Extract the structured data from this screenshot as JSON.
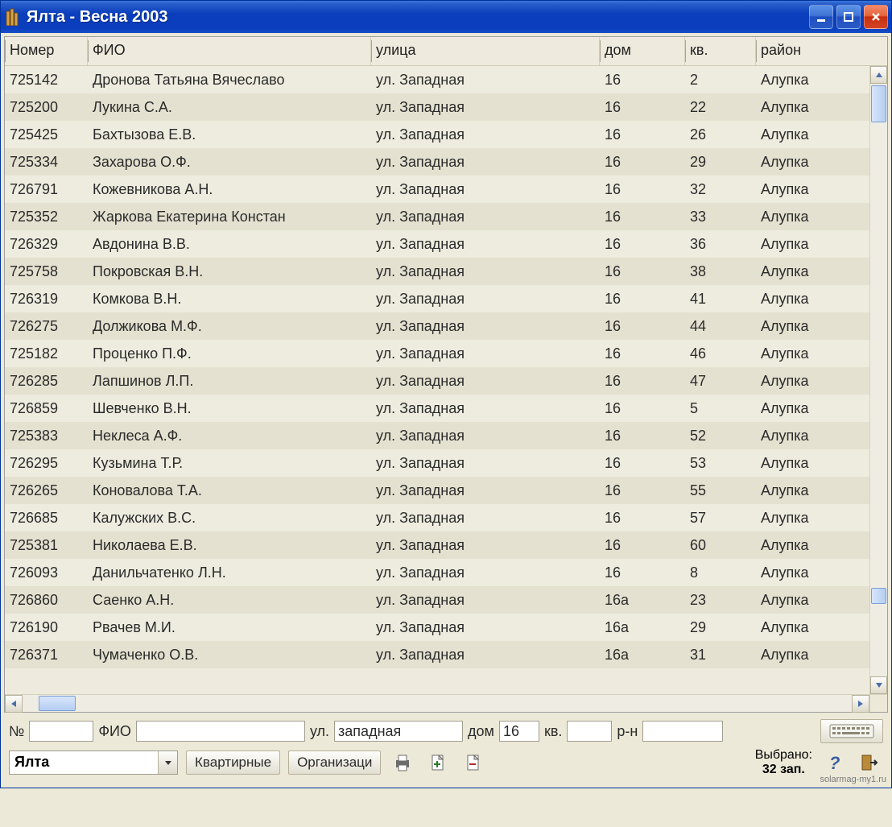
{
  "window": {
    "title": "Ялта  - Весна 2003"
  },
  "columns": {
    "num": "Номер",
    "fio": "ФИО",
    "street": "улица",
    "house": "дом",
    "apt": "кв.",
    "district": "район"
  },
  "rows": [
    {
      "num": "725142",
      "fio": "Дронова Татьяна Вячеславо",
      "street": "ул. Западная",
      "house": "16",
      "apt": "2",
      "district": "Алупка"
    },
    {
      "num": "725200",
      "fio": "Лукина С.А.",
      "street": "ул. Западная",
      "house": "16",
      "apt": "22",
      "district": "Алупка"
    },
    {
      "num": "725425",
      "fio": "Бахтызова Е.В.",
      "street": "ул. Западная",
      "house": "16",
      "apt": "26",
      "district": "Алупка"
    },
    {
      "num": "725334",
      "fio": "Захарова О.Ф.",
      "street": "ул. Западная",
      "house": "16",
      "apt": "29",
      "district": "Алупка"
    },
    {
      "num": "726791",
      "fio": "Кожевникова А.Н.",
      "street": "ул. Западная",
      "house": "16",
      "apt": "32",
      "district": "Алупка"
    },
    {
      "num": "725352",
      "fio": "Жаркова Екатерина Констан",
      "street": "ул. Западная",
      "house": "16",
      "apt": "33",
      "district": "Алупка"
    },
    {
      "num": "726329",
      "fio": "Авдонина В.В.",
      "street": "ул. Западная",
      "house": "16",
      "apt": "36",
      "district": "Алупка"
    },
    {
      "num": "725758",
      "fio": "Покровская В.Н.",
      "street": "ул. Западная",
      "house": "16",
      "apt": "38",
      "district": "Алупка"
    },
    {
      "num": "726319",
      "fio": "Комкова В.Н.",
      "street": "ул. Западная",
      "house": "16",
      "apt": "41",
      "district": "Алупка"
    },
    {
      "num": "726275",
      "fio": "Должикова М.Ф.",
      "street": "ул. Западная",
      "house": "16",
      "apt": "44",
      "district": "Алупка"
    },
    {
      "num": "725182",
      "fio": "Проценко П.Ф.",
      "street": "ул. Западная",
      "house": "16",
      "apt": "46",
      "district": "Алупка"
    },
    {
      "num": "726285",
      "fio": "Лапшинов Л.П.",
      "street": "ул. Западная",
      "house": "16",
      "apt": "47",
      "district": "Алупка"
    },
    {
      "num": "726859",
      "fio": "Шевченко В.Н.",
      "street": "ул. Западная",
      "house": "16",
      "apt": "5",
      "district": "Алупка"
    },
    {
      "num": "725383",
      "fio": "Неклеса А.Ф.",
      "street": "ул. Западная",
      "house": "16",
      "apt": "52",
      "district": "Алупка"
    },
    {
      "num": "726295",
      "fio": "Кузьмина Т.Р.",
      "street": "ул. Западная",
      "house": "16",
      "apt": "53",
      "district": "Алупка"
    },
    {
      "num": "726265",
      "fio": "Коновалова Т.А.",
      "street": "ул. Западная",
      "house": "16",
      "apt": "55",
      "district": "Алупка"
    },
    {
      "num": "726685",
      "fio": "Калужских В.С.",
      "street": "ул. Западная",
      "house": "16",
      "apt": "57",
      "district": "Алупка"
    },
    {
      "num": "725381",
      "fio": "Николаева Е.В.",
      "street": "ул. Западная",
      "house": "16",
      "apt": "60",
      "district": "Алупка"
    },
    {
      "num": "726093",
      "fio": "Данильчатенко Л.Н.",
      "street": "ул. Западная",
      "house": "16",
      "apt": "8",
      "district": "Алупка"
    },
    {
      "num": "726860",
      "fio": "Саенко А.Н.",
      "street": "ул. Западная",
      "house": "16а",
      "apt": "23",
      "district": "Алупка"
    },
    {
      "num": "726190",
      "fio": "Рвачев М.И.",
      "street": "ул. Западная",
      "house": "16а",
      "apt": "29",
      "district": "Алупка"
    },
    {
      "num": "726371",
      "fio": "Чумаченко О.В.",
      "street": "ул. Западная",
      "house": "16а",
      "apt": "31",
      "district": "Алупка"
    }
  ],
  "filter": {
    "labels": {
      "num": "№",
      "fio": "ФИО",
      "street": "ул.",
      "house": "дом",
      "apt": "кв.",
      "district": "р-н"
    },
    "values": {
      "num": "",
      "fio": "",
      "street": "западная",
      "house": "16",
      "apt": "",
      "district": ""
    }
  },
  "toolbar": {
    "city": "Ялта",
    "btn_residential": "Квартирные",
    "btn_organizations": "Организаци",
    "status_label": "Выбрано:",
    "status_count": "32 зап."
  },
  "watermark": "solarmag-my1.ru"
}
